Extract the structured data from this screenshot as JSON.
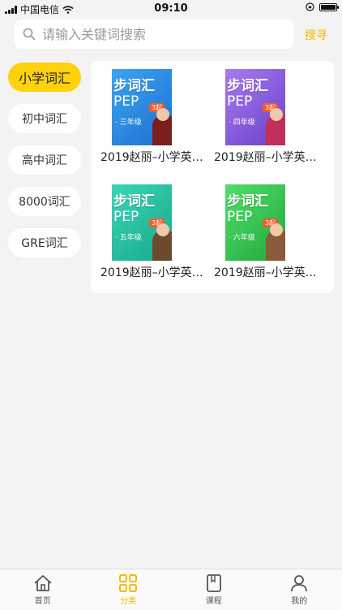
{
  "status_bar": {
    "carrier": "中国电信",
    "time": "09:10"
  },
  "search": {
    "placeholder": "请输入关键词搜索",
    "button_label": "搜寻"
  },
  "categories": [
    {
      "label": "小学词汇",
      "active": true
    },
    {
      "label": "初中词汇",
      "active": false
    },
    {
      "label": "高中词汇",
      "active": false
    },
    {
      "label": "8000词汇",
      "active": false
    },
    {
      "label": "GRE词汇",
      "active": false
    }
  ],
  "books": [
    {
      "title": "2019赵丽–小学英…",
      "cover_title": "步词汇",
      "cover_pep": "PEP",
      "cover_badge": "3起",
      "cover_grade": "· 三年级",
      "color": "#2f8fe0"
    },
    {
      "title": "2019赵丽–小学英…",
      "cover_title": "步词汇",
      "cover_pep": "PEP",
      "cover_badge": "3起",
      "cover_grade": "· 四年级",
      "color": "#8c5fe0"
    },
    {
      "title": "2019赵丽–小学英…",
      "cover_title": "步词汇",
      "cover_pep": "PEP",
      "cover_badge": "3起",
      "cover_grade": "· 五年级",
      "color": "#1fc7a6"
    },
    {
      "title": "2019赵丽–小学英…",
      "cover_title": "步词汇",
      "cover_pep": "PEP",
      "cover_badge": "3起",
      "cover_grade": "· 六年级",
      "color": "#2ecc4f"
    }
  ],
  "tabbar": [
    {
      "label": "首页",
      "icon": "home-icon",
      "active": false
    },
    {
      "label": "分类",
      "icon": "grid-icon",
      "active": true
    },
    {
      "label": "课程",
      "icon": "book-icon",
      "active": false
    },
    {
      "label": "我的",
      "icon": "user-icon",
      "active": false
    }
  ],
  "colors": {
    "accent": "#ffd20e",
    "accent_text": "#f5b800",
    "background": "#f3f3f3"
  }
}
